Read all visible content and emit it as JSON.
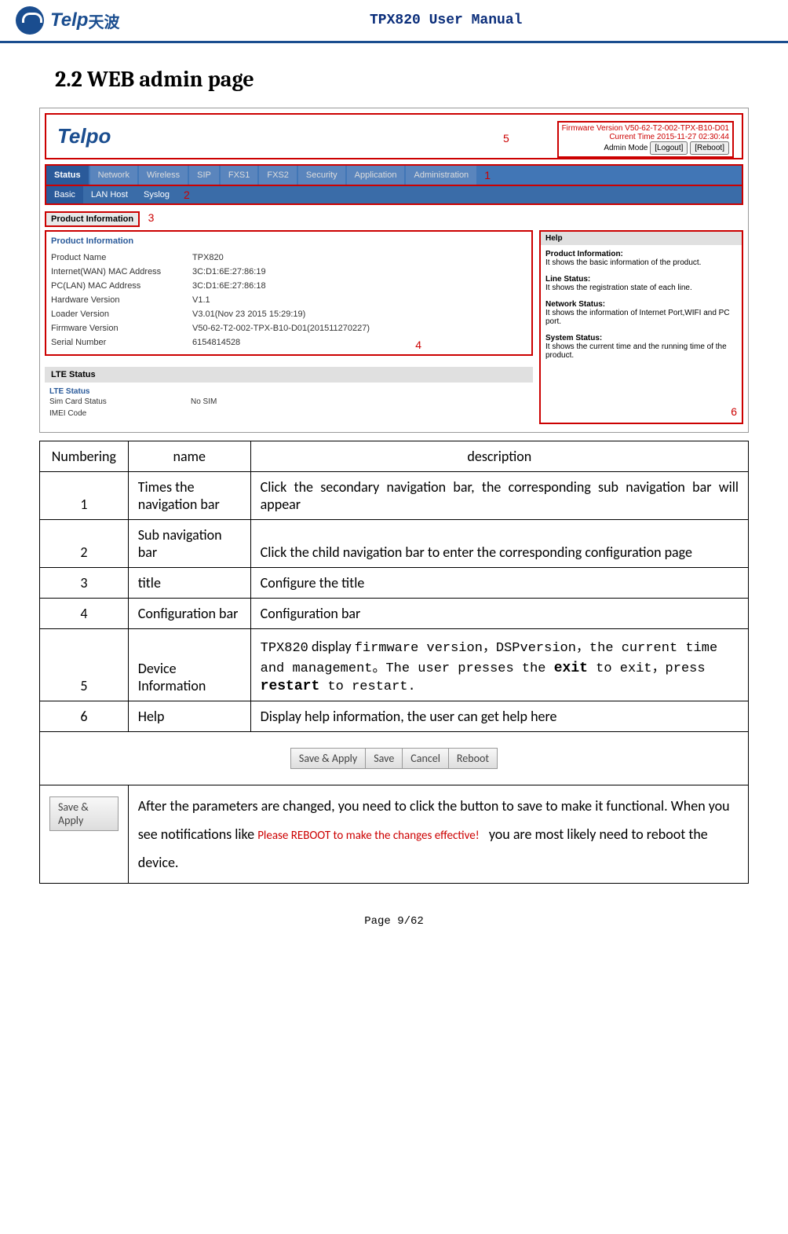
{
  "header": {
    "logo_text": "Telp",
    "logo_cn": "天波",
    "doc_title": "TPX820 User Manual"
  },
  "section": {
    "heading": "2.2 WEB admin page"
  },
  "screenshot": {
    "logo": "Telpo",
    "topright": {
      "firmware": "Firmware Version V50-62-T2-002-TPX-B10-D01",
      "time": "Current Time 2015-11-27 02:30:44",
      "mode": "Admin Mode",
      "logout": "[Logout]",
      "reboot": "[Reboot]"
    },
    "markers": {
      "m1": "1",
      "m2": "2",
      "m3": "3",
      "m4": "4",
      "m5": "5",
      "m6": "6"
    },
    "nav1": [
      "Status",
      "Network",
      "Wireless",
      "SIP",
      "FXS1",
      "FXS2",
      "Security",
      "Application",
      "Administration"
    ],
    "nav2": [
      "Basic",
      "LAN Host",
      "Syslog"
    ],
    "prod_info_title": "Product Information",
    "prod_subtitle": "Product Information",
    "product_rows": [
      {
        "label": "Product Name",
        "val": "TPX820"
      },
      {
        "label": "Internet(WAN) MAC Address",
        "val": "3C:D1:6E:27:86:19"
      },
      {
        "label": "PC(LAN) MAC Address",
        "val": "3C:D1:6E:27:86:18"
      },
      {
        "label": "Hardware Version",
        "val": "V1.1"
      },
      {
        "label": "Loader Version",
        "val": "V3.01(Nov 23 2015 15:29:19)"
      },
      {
        "label": "Firmware Version",
        "val": "V50-62-T2-002-TPX-B10-D01(201511270227)"
      },
      {
        "label": "Serial Number",
        "val": "6154814528"
      }
    ],
    "lte_head": "LTE Status",
    "lte_sub": "LTE Status",
    "lte_rows": [
      {
        "label": "Sim Card Status",
        "val": "No SIM"
      },
      {
        "label": "IMEI Code",
        "val": ""
      }
    ],
    "help_head": "Help",
    "help": [
      {
        "title": "Product Information:",
        "text": "It shows the basic information of the product."
      },
      {
        "title": "Line Status:",
        "text": "It shows the registration state of each line."
      },
      {
        "title": "Network Status:",
        "text": "It shows the information of Internet Port,WIFI and PC port."
      },
      {
        "title": "System Status:",
        "text": "It shows the current time and the running time of the product."
      }
    ]
  },
  "table": {
    "headers": {
      "num": "Numbering",
      "name": "name",
      "desc": "description"
    },
    "rows": [
      {
        "num": "1",
        "name": "Times the navigation bar",
        "desc": "Click the secondary navigation bar, the corresponding sub navigation bar will appear"
      },
      {
        "num": "2",
        "name": "Sub navigation bar",
        "desc": "Click the child navigation bar to enter the corresponding configuration page"
      },
      {
        "num": "3",
        "name": "title",
        "desc": "Configure the title"
      },
      {
        "num": "4",
        "name": "Configuration bar",
        "desc": "Configuration bar"
      },
      {
        "num": "5",
        "name": "Device Information",
        "desc_html": true
      },
      {
        "num": "6",
        "name": "Help",
        "desc": "Display help information, the user can get help here"
      }
    ],
    "row5": {
      "p1a": "TPX820",
      "p1b": " display ",
      "p1c": "firmware version",
      "p2a": "，DSP",
      "p2b": "version，the current time and management。The user presses the ",
      "p2c": "exit",
      "p2d": " to exit，press ",
      "p2e": "restart",
      "p2f": " to restart."
    },
    "buttons": [
      "Save & Apply",
      "Save",
      "Cancel",
      "Reboot"
    ],
    "save_apply_btn": "Save & Apply",
    "save_desc_1": "After the parameters are changed, you need to click the button to save to make it functional. When you see notifications like",
    "save_notice": "Please REBOOT to make the changes effective!",
    "save_desc_2": "you are most likely need to reboot the device."
  },
  "footer": "Page 9/62"
}
